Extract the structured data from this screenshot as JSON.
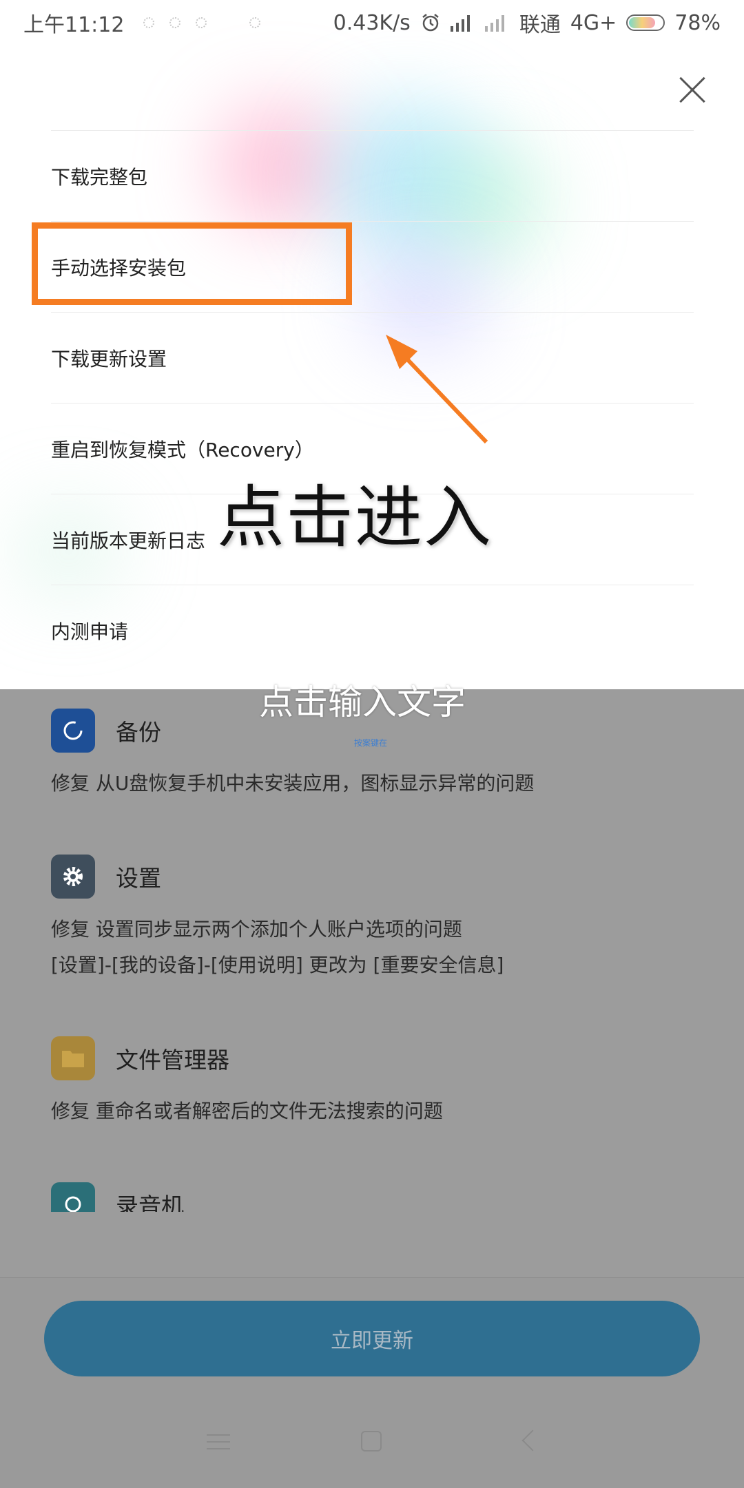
{
  "status_bar": {
    "time": "上午11:12",
    "net_speed": "0.43K/s",
    "carrier": "联通",
    "network": "4G+",
    "battery": "78%"
  },
  "menu": {
    "items": [
      {
        "label": "下载完整包"
      },
      {
        "label": "手动选择安装包"
      },
      {
        "label": "下载更新设置"
      },
      {
        "label": "重启到恢复模式（Recovery）"
      },
      {
        "label": "当前版本更新日志"
      },
      {
        "label": "内测申请"
      }
    ]
  },
  "annotation": {
    "highlight_color": "#f57c22",
    "caption": "点击进入",
    "placeholder_caption": "点击输入文字",
    "tiny_caption": "按案键在"
  },
  "changelog": {
    "entries": [
      {
        "app": "备份",
        "icon": "backup-icon",
        "lines": [
          "修复 从U盘恢复手机中未安装应用，图标显示异常的问题"
        ]
      },
      {
        "app": "设置",
        "icon": "gear-icon",
        "lines": [
          "修复 设置同步显示两个添加个人账户选项的问题",
          "[设置]-[我的设备]-[使用说明] 更改为 [重要安全信息]"
        ]
      },
      {
        "app": "文件管理器",
        "icon": "folder-icon",
        "lines": [
          "修复 重命名或者解密后的文件无法搜索的问题"
        ]
      },
      {
        "app": "录音机",
        "icon": "recorder-icon",
        "lines": []
      }
    ]
  },
  "bottom": {
    "update_button_label": "立即更新"
  }
}
